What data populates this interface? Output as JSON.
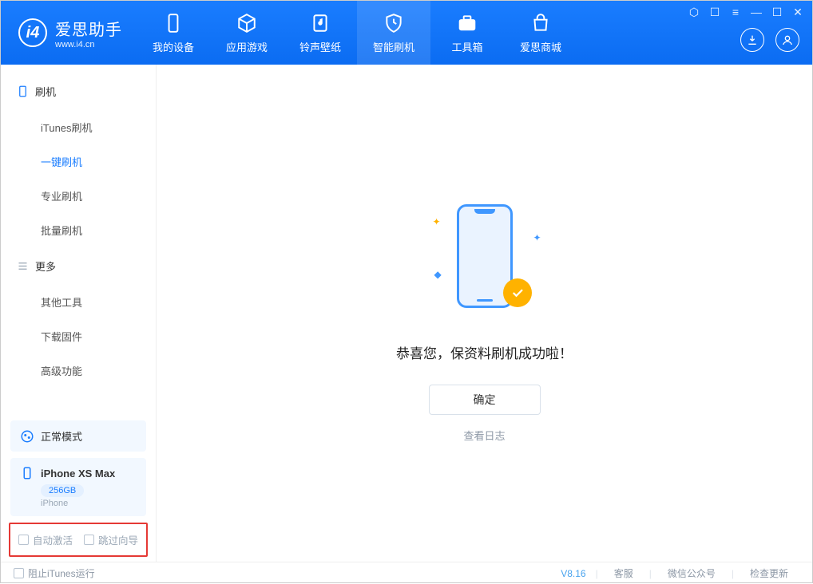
{
  "app": {
    "title": "爱思助手",
    "subtitle": "www.i4.cn",
    "version": "V8.16"
  },
  "tabs": [
    {
      "label": "我的设备"
    },
    {
      "label": "应用游戏"
    },
    {
      "label": "铃声壁纸"
    },
    {
      "label": "智能刷机",
      "active": true
    },
    {
      "label": "工具箱"
    },
    {
      "label": "爱思商城"
    }
  ],
  "sidebar": {
    "group1_title": "刷机",
    "items1": [
      {
        "label": "iTunes刷机"
      },
      {
        "label": "一键刷机",
        "active": true
      },
      {
        "label": "专业刷机"
      },
      {
        "label": "批量刷机"
      }
    ],
    "group2_title": "更多",
    "items2": [
      {
        "label": "其他工具"
      },
      {
        "label": "下载固件"
      },
      {
        "label": "高级功能"
      }
    ],
    "mode": "正常模式",
    "device_name": "iPhone XS Max",
    "device_capacity": "256GB",
    "device_type": "iPhone",
    "opt_auto_activate": "自动激活",
    "opt_skip_guide": "跳过向导"
  },
  "main": {
    "success_title": "恭喜您，保资料刷机成功啦！",
    "ok_label": "确定",
    "view_log": "查看日志"
  },
  "footer": {
    "block_itunes": "阻止iTunes运行",
    "links": [
      "客服",
      "微信公众号",
      "检查更新"
    ]
  }
}
